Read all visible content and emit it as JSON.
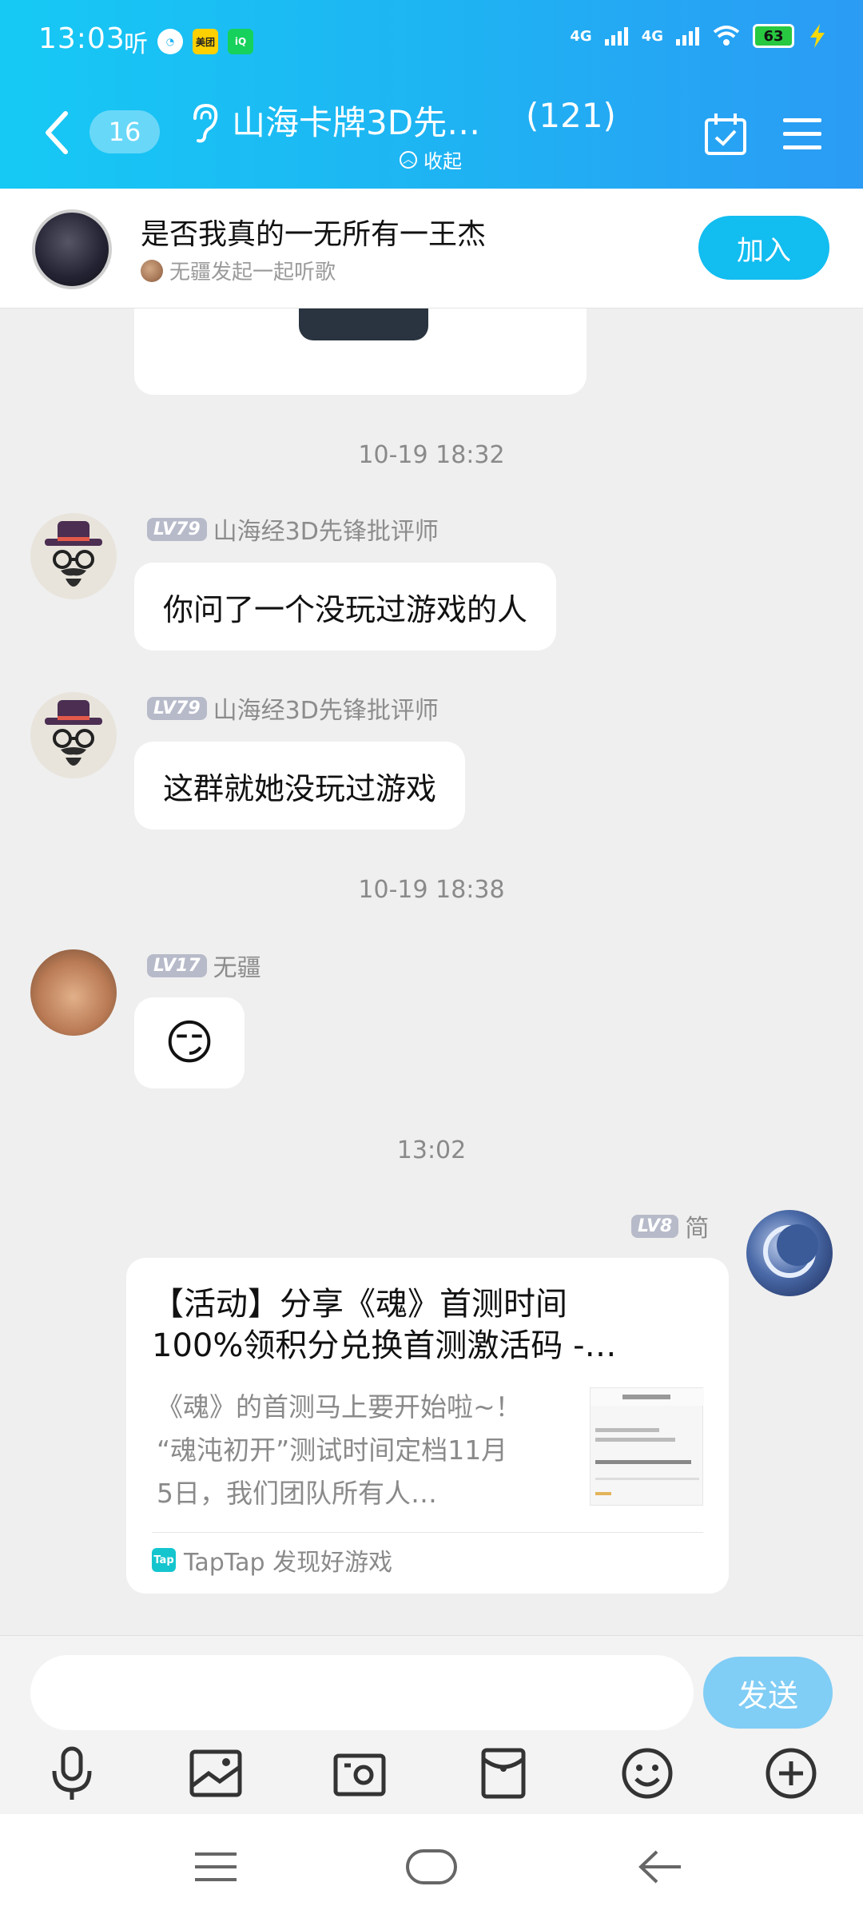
{
  "status": {
    "time": "13:03",
    "left_icons": [
      "听",
      "meituan-icon",
      "iqiyi-icon"
    ],
    "network_1": "4G",
    "network_2": "4G",
    "battery": "63"
  },
  "header": {
    "unread_count": "16",
    "group_title": "山海卡牌3D先…",
    "member_count": "(121)",
    "collapse_label": "收起"
  },
  "listen": {
    "song_title": "是否我真的一无所有一王杰",
    "subtitle": "无疆发起一起听歌",
    "join_label": "加入"
  },
  "messages": {
    "ts1": "10-19 18:32",
    "m1": {
      "level": "LV79",
      "name": "山海经3D先锋批评师",
      "text": "你问了一个没玩过游戏的人"
    },
    "m2": {
      "level": "LV79",
      "name": "山海经3D先锋批评师",
      "text": "这群就她没玩过游戏"
    },
    "ts2": "10-19 18:38",
    "m3": {
      "level": "LV17",
      "name": "无疆",
      "emoji": "😏"
    },
    "ts3": "13:02",
    "m4": {
      "level": "LV8",
      "name": "简",
      "card_title_line1": "【活动】分享《魂》首测时间",
      "card_title_line2": "100%领积分兑换首测激活码 -…",
      "card_desc_line1": "《魂》的首测马上要开始啦~！",
      "card_desc_line2": "“魂沌初开”测试时间定档11月",
      "card_desc_line3": "5日，我们团队所有人…",
      "card_source": "TapTap 发现好游戏",
      "tap_logo": "Tap"
    }
  },
  "input": {
    "placeholder": "",
    "send_label": "发送"
  },
  "toolbar": [
    "microphone-icon",
    "image-icon",
    "camera-icon",
    "red-packet-icon",
    "emoji-icon",
    "plus-icon"
  ],
  "colors": {
    "header_start": "#16c9f4",
    "header_end": "#2b9bf4",
    "join": "#12bdf0",
    "send": "#80cdf5",
    "level_badge": "#b7bac9"
  }
}
